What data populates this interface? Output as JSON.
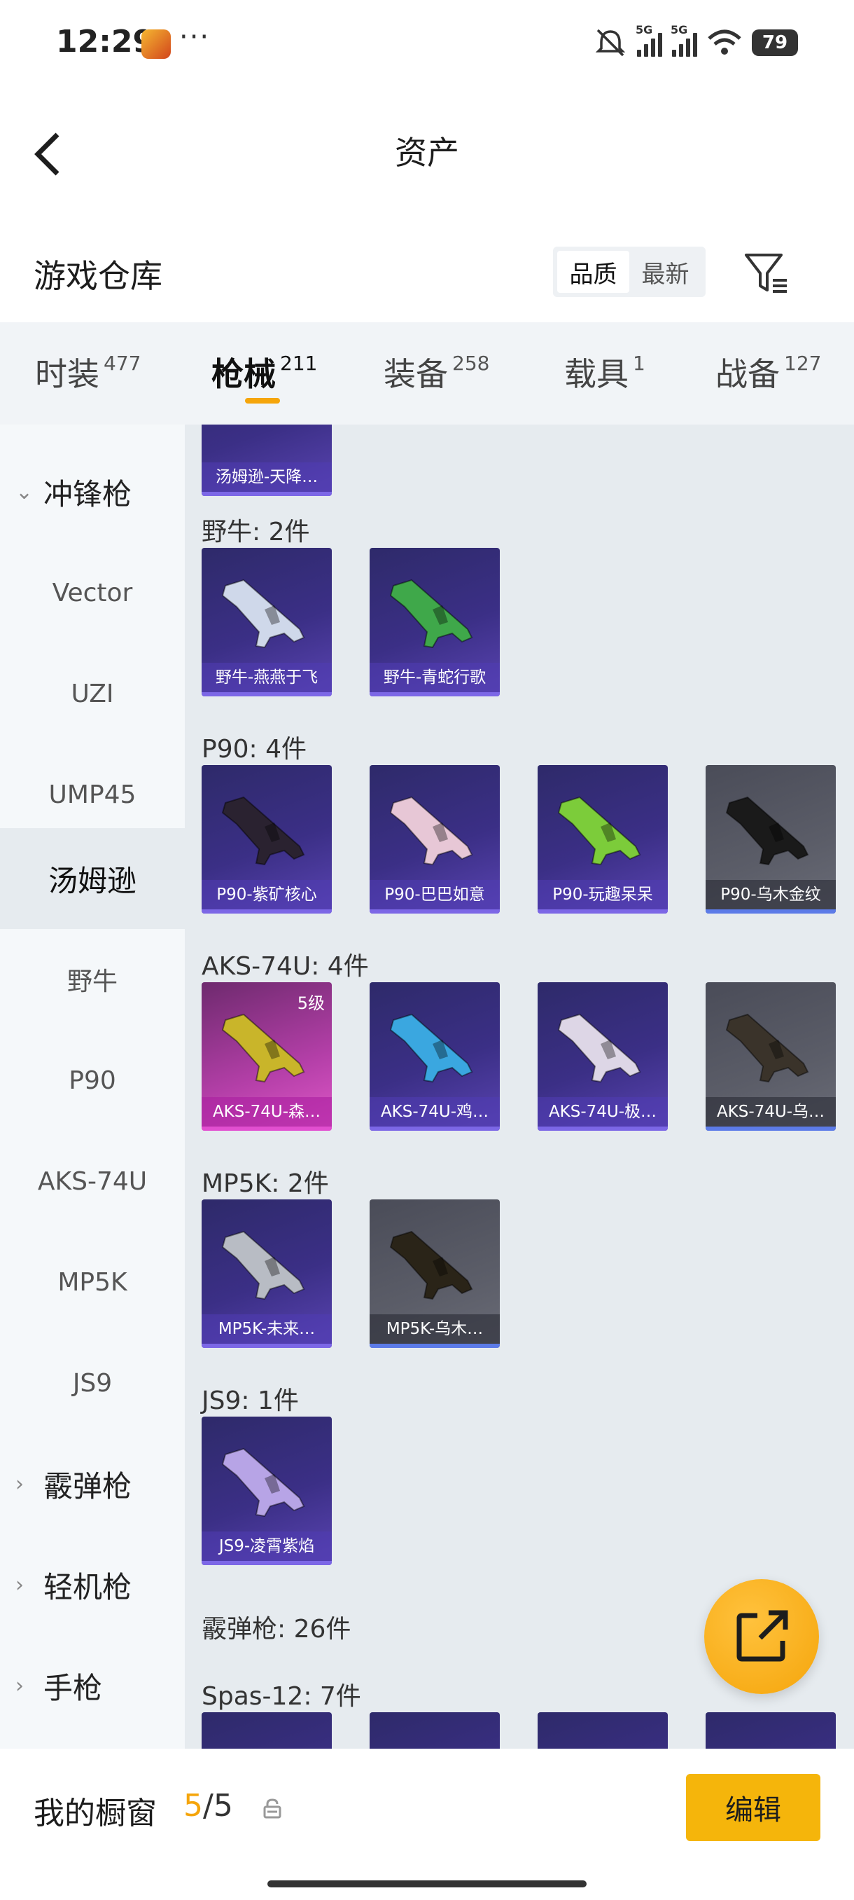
{
  "status_bar": {
    "time": "12:29",
    "dots": "···",
    "net1": "5G",
    "net2": "5G",
    "battery": "79"
  },
  "header": {
    "title": "资产"
  },
  "section": {
    "title": "游戏仓库",
    "sort_options": [
      "品质",
      "最新"
    ],
    "active_sort": "品质"
  },
  "tabs": [
    {
      "label": "时装",
      "count": "477"
    },
    {
      "label": "枪械",
      "count": "211",
      "active": true
    },
    {
      "label": "装备",
      "count": "258"
    },
    {
      "label": "载具",
      "count": "1"
    },
    {
      "label": "战备",
      "count": "127"
    }
  ],
  "sidebar": {
    "groups": {
      "smg": "冲锋枪",
      "shotgun": "霰弹枪",
      "lmg": "轻机枪",
      "pistol": "手枪"
    },
    "items": [
      "Vector",
      "UZI",
      "UMP45",
      "汤姆逊",
      "野牛",
      "P90",
      "AKS-74U",
      "MP5K",
      "JS9"
    ],
    "active": "汤姆逊"
  },
  "content": {
    "top_card": "汤姆逊-天降…",
    "groups": [
      {
        "title": "野牛: 2件",
        "cards": [
          {
            "name": "野牛-燕燕于飞",
            "style": "purple",
            "color": "#cfd8ea"
          },
          {
            "name": "野牛-青蛇行歌",
            "style": "purple",
            "color": "#3fa84a"
          }
        ]
      },
      {
        "title": "P90: 4件",
        "cards": [
          {
            "name": "P90-紫矿核心",
            "style": "purple",
            "color": "#2a2230"
          },
          {
            "name": "P90-巴巴如意",
            "style": "purple",
            "color": "#e7c7d6"
          },
          {
            "name": "P90-玩趣呆呆",
            "style": "purple",
            "color": "#7ccc3a"
          },
          {
            "name": "P90-乌木金纹",
            "style": "gray",
            "color": "#1a1a1a"
          }
        ]
      },
      {
        "title": "AKS-74U: 4件",
        "cards": [
          {
            "name": "AKS-74U-森…",
            "style": "pink",
            "color": "#c9b52a",
            "level": "5级"
          },
          {
            "name": "AKS-74U-鸡…",
            "style": "purple",
            "color": "#3aa7e0"
          },
          {
            "name": "AKS-74U-极…",
            "style": "purple",
            "color": "#ddd6e6"
          },
          {
            "name": "AKS-74U-乌…",
            "style": "gray",
            "color": "#3a332a"
          }
        ]
      },
      {
        "title": "MP5K: 2件",
        "cards": [
          {
            "name": "MP5K-未来…",
            "style": "purple",
            "color": "#b8bcc4"
          },
          {
            "name": "MP5K-乌木…",
            "style": "gray",
            "color": "#2a2418"
          }
        ]
      },
      {
        "title": "JS9: 1件",
        "cards": [
          {
            "name": "JS9-凌霄紫焰",
            "style": "purple",
            "color": "#b7a4e6"
          }
        ]
      }
    ],
    "shotgun_title": "霰弹枪: 26件",
    "spas_title": "Spas-12: 7件"
  },
  "bottom": {
    "label": "我的橱窗",
    "current": "5",
    "separator": "/",
    "max": "5",
    "edit_label": "编辑"
  },
  "colors": {
    "accent": "#f5a50b",
    "edit_button": "#f5b50b",
    "page_bg": "#e6ebef"
  }
}
